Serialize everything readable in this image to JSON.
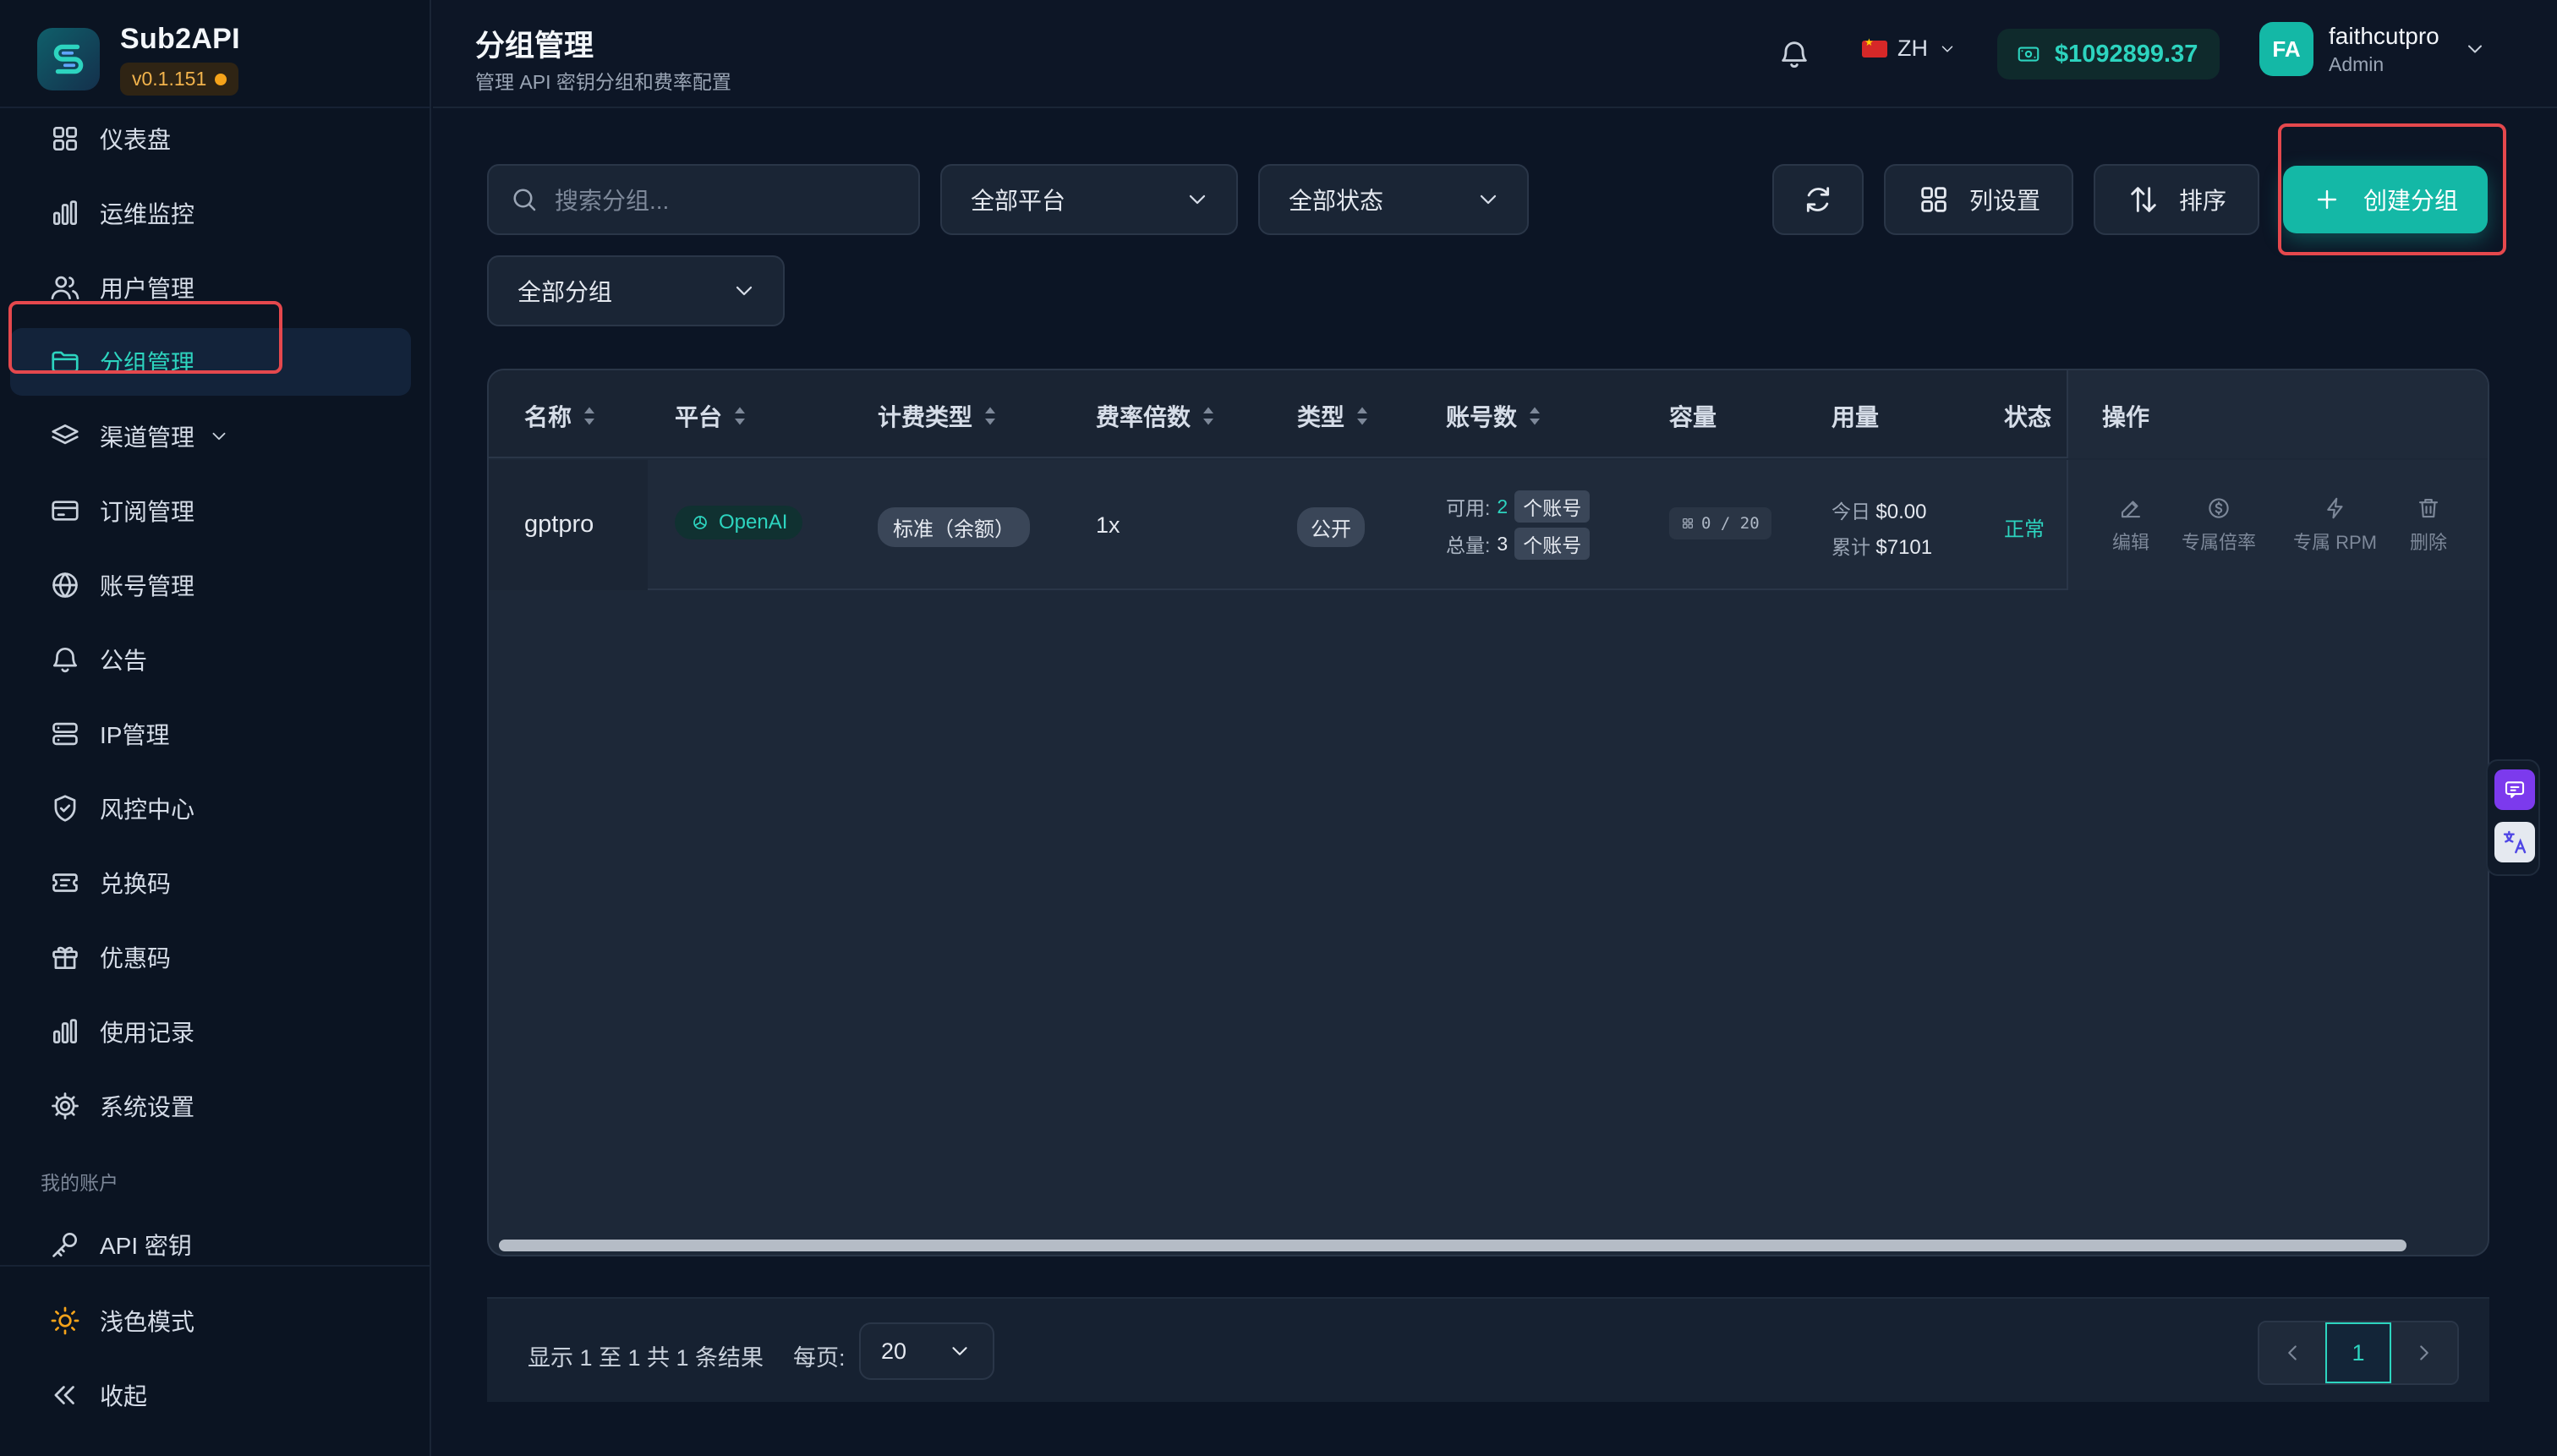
{
  "brand": {
    "name": "Sub2API",
    "version": "v0.1.151"
  },
  "sidebar": {
    "items": [
      {
        "label": "仪表盘",
        "icon": "dashboard-icon"
      },
      {
        "label": "运维监控",
        "icon": "bar-chart-icon"
      },
      {
        "label": "用户管理",
        "icon": "users-icon"
      },
      {
        "label": "分组管理",
        "icon": "folder-icon",
        "active": true
      },
      {
        "label": "渠道管理",
        "icon": "layers-icon",
        "has_children": true
      },
      {
        "label": "订阅管理",
        "icon": "credit-card-icon"
      },
      {
        "label": "账号管理",
        "icon": "globe-icon"
      },
      {
        "label": "公告",
        "icon": "bell-icon"
      },
      {
        "label": "IP管理",
        "icon": "server-icon"
      },
      {
        "label": "风控中心",
        "icon": "shield-icon"
      },
      {
        "label": "兑换码",
        "icon": "ticket-icon"
      },
      {
        "label": "优惠码",
        "icon": "gift-icon"
      },
      {
        "label": "使用记录",
        "icon": "bar-chart-icon"
      },
      {
        "label": "系统设置",
        "icon": "gear-icon"
      }
    ],
    "section_label": "我的账户",
    "account_items": [
      {
        "label": "API 密钥",
        "icon": "key-icon"
      }
    ],
    "theme_toggle": "浅色模式",
    "collapse": "收起"
  },
  "header": {
    "title": "分组管理",
    "subtitle": "管理 API 密钥分组和费率配置",
    "language": "ZH",
    "balance": "$1092899.37",
    "user": {
      "initials": "FA",
      "name": "faithcutpro",
      "role": "Admin"
    }
  },
  "toolbar": {
    "search_placeholder": "搜索分组...",
    "platform_filter": "全部平台",
    "status_filter": "全部状态",
    "group_filter": "全部分组",
    "columns_label": "列设置",
    "sort_label": "排序",
    "create_label": "创建分组"
  },
  "table": {
    "columns": [
      "名称",
      "平台",
      "计费类型",
      "费率倍数",
      "类型",
      "账号数",
      "容量",
      "用量",
      "状态",
      "操作"
    ],
    "rows": [
      {
        "name": "gptpro",
        "platform": "OpenAI",
        "billing_type": "标准（余额）",
        "rate": "1x",
        "type": "公开",
        "available_label": "可用:",
        "available_count": "2",
        "total_label": "总量:",
        "total_count": "3",
        "account_unit": "个账号",
        "capacity": "0 / 20",
        "today_label": "今日",
        "today_value": "$0.00",
        "cumulative_label": "累计",
        "cumulative_value": "$7101",
        "status": "正常",
        "actions": [
          "编辑",
          "专属倍率",
          "专属 RPM",
          "删除"
        ]
      }
    ]
  },
  "footer": {
    "summary": "显示 1 至 1 共 1 条结果",
    "per_page_label": "每页:",
    "per_page_value": "20",
    "current_page": "1"
  },
  "colors": {
    "accent": "#14b8a6",
    "highlight": "#e5484d",
    "background": "#0c1525"
  }
}
